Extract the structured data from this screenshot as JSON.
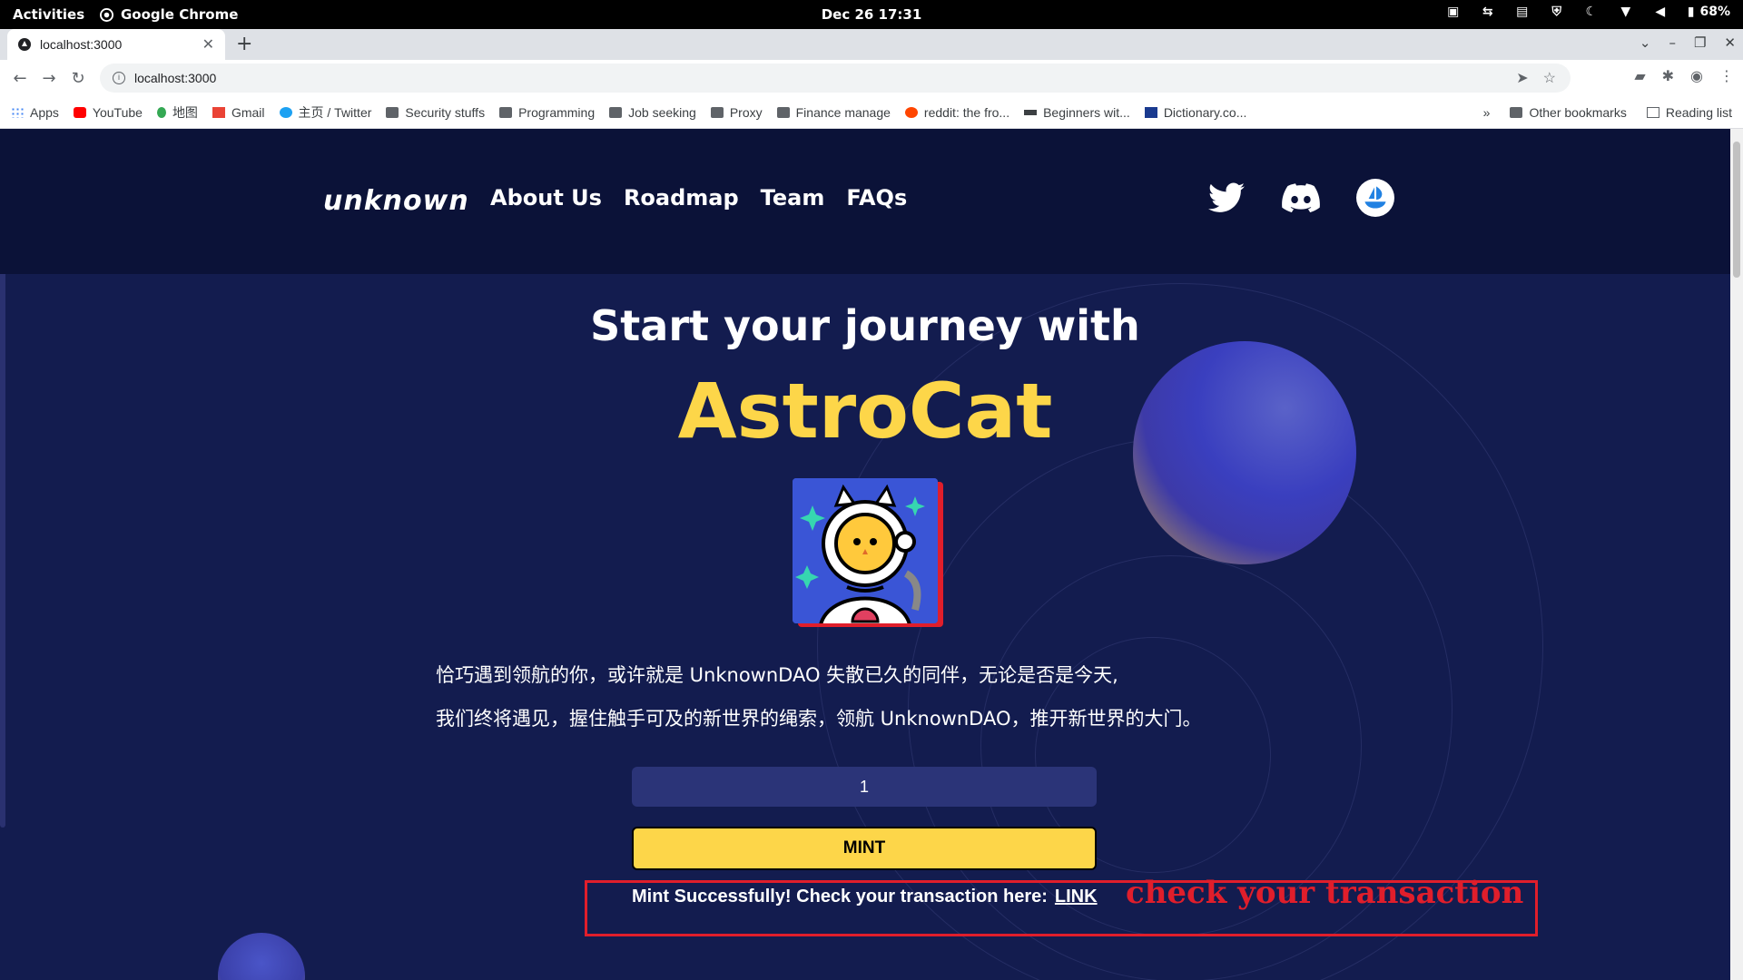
{
  "system": {
    "activities": "Activities",
    "app_name": "Google Chrome",
    "clock": "Dec 26  17:31",
    "battery": "68%"
  },
  "browser": {
    "tab_title": "localhost:3000",
    "url": "localhost:3000",
    "bookmarks": [
      {
        "label": "Apps",
        "icon": "apps-icon"
      },
      {
        "label": "YouTube",
        "icon": "youtube-icon"
      },
      {
        "label": "地图",
        "icon": "maps-icon"
      },
      {
        "label": "Gmail",
        "icon": "gmail-icon"
      },
      {
        "label": "主页 / Twitter",
        "icon": "twitter-icon"
      },
      {
        "label": "Security stuffs",
        "icon": "folder-icon"
      },
      {
        "label": "Programming",
        "icon": "folder-icon"
      },
      {
        "label": "Job seeking",
        "icon": "folder-icon"
      },
      {
        "label": "Proxy",
        "icon": "folder-icon"
      },
      {
        "label": "Finance manage",
        "icon": "folder-icon"
      },
      {
        "label": "reddit: the fro...",
        "icon": "reddit-icon"
      },
      {
        "label": "Beginners wit...",
        "icon": "link-icon"
      },
      {
        "label": "Dictionary.co...",
        "icon": "dictionary-icon"
      }
    ],
    "bookmarks_more": "»",
    "other_bookmarks": "Other bookmarks",
    "reading_list": "Reading list"
  },
  "site": {
    "logo": "unknown",
    "nav": [
      "About Us",
      "Roadmap",
      "Team",
      "FAQs"
    ],
    "hero_line1": "Start your journey with",
    "hero_line2": "AstroCat",
    "desc_line1": "恰巧遇到领航的你，或许就是 UnknownDAO 失散已久的同伴，无论是否是今天,",
    "desc_line2": "我们终将遇见，握住触手可及的新世界的绳索，领航 UnknownDAO，推开新世界的大门。",
    "quantity": "1",
    "mint_label": "MINT",
    "success_text": "Mint Successfully! Check your transaction here:",
    "success_link": "LINK",
    "annotation": "check your transaction"
  },
  "colors": {
    "accent_yellow": "#fdd649",
    "annotation_red": "#e01e2b",
    "page_bg": "#131c4f",
    "header_bg": "#0b1238"
  }
}
